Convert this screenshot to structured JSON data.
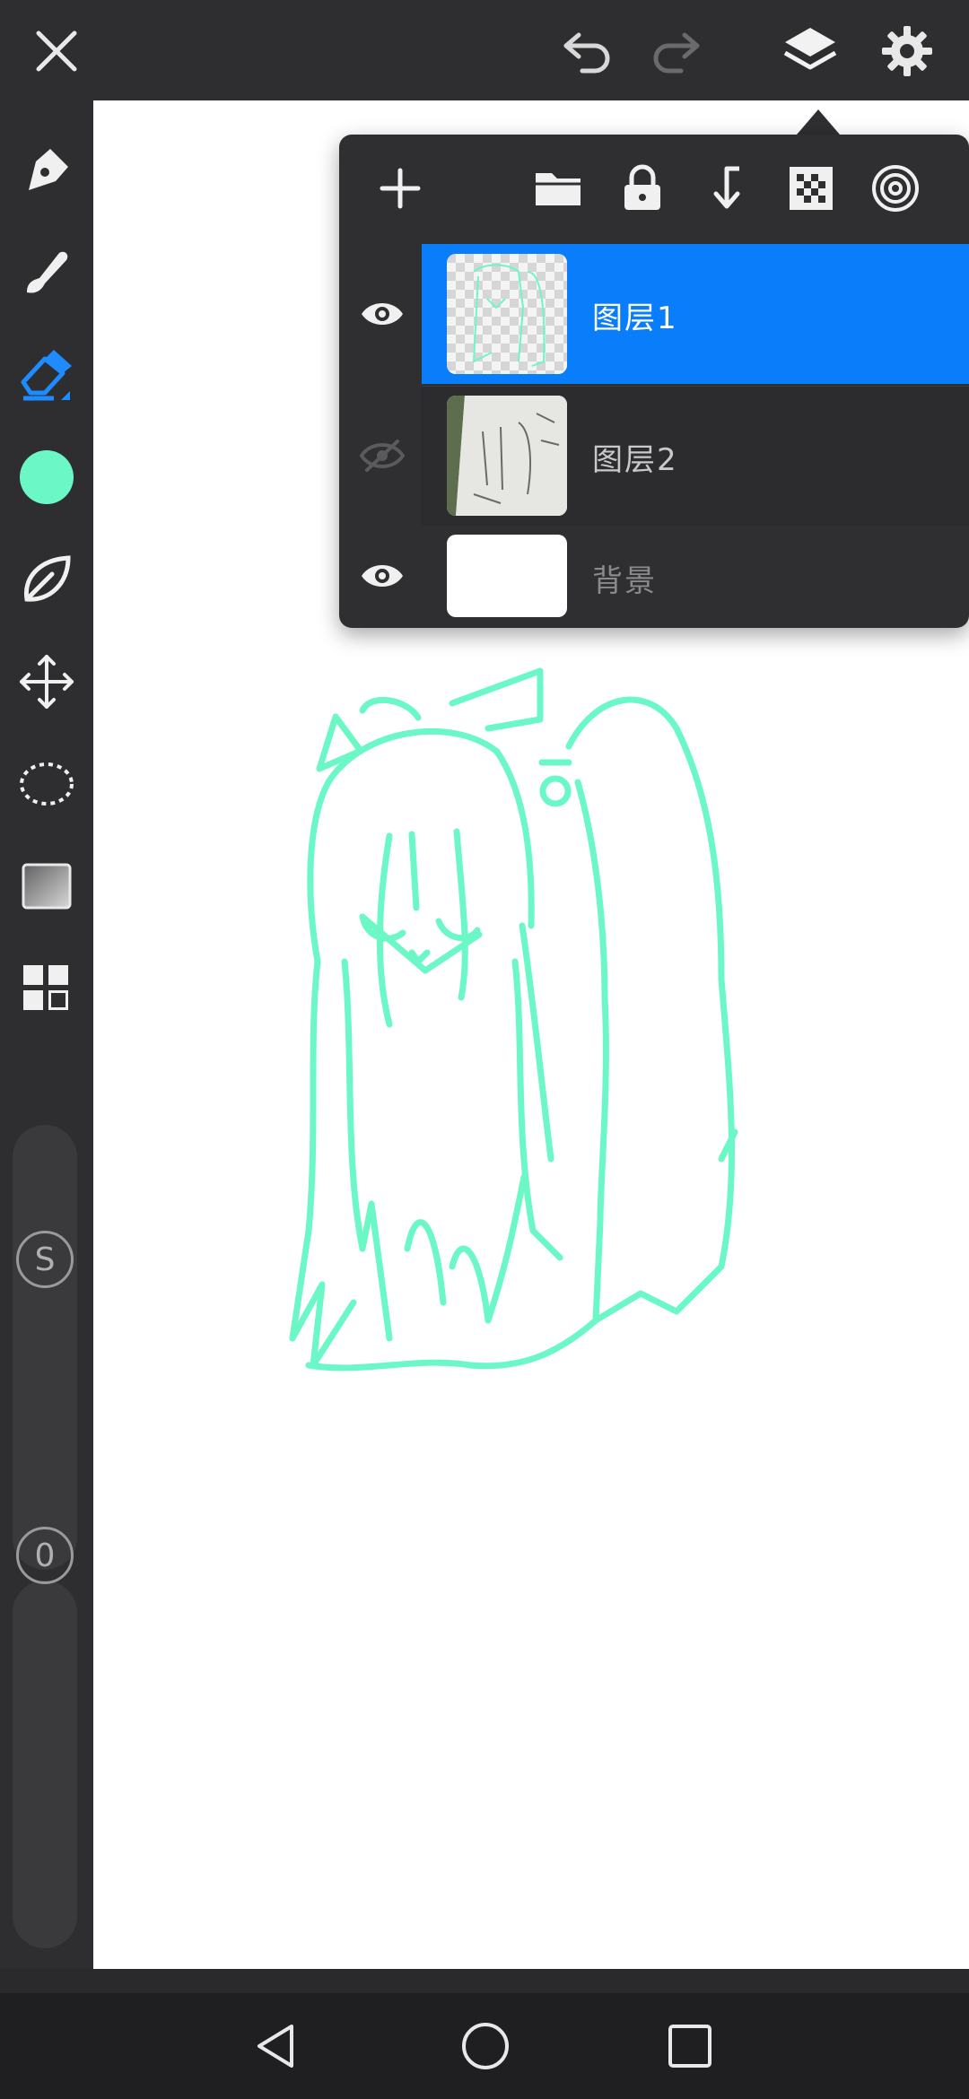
{
  "topbar": {
    "icons": [
      "close-icon",
      "undo-icon",
      "redo-icon",
      "layers-icon",
      "gear-icon"
    ]
  },
  "sidebar": {
    "tools": [
      "pen-icon",
      "brush-icon",
      "eraser-icon",
      "color-swatch",
      "leaf-icon",
      "move-icon",
      "lasso-icon",
      "gradient-icon",
      "grid-icon"
    ],
    "active_tool": "eraser-icon",
    "current_color": "#6cf7c7",
    "size_label": "S",
    "opacity_label": "0"
  },
  "layer_panel": {
    "toolbar_icons": [
      "plus-icon",
      "folder-icon",
      "lock-icon",
      "merge-down-icon",
      "checker-icon",
      "target-icon"
    ],
    "layers": [
      {
        "name": "图层1",
        "visible": true,
        "selected": true
      },
      {
        "name": "图层2",
        "visible": false,
        "selected": false
      },
      {
        "name": "背景",
        "visible": true,
        "selected": false
      }
    ]
  },
  "navbar": {
    "icons": [
      "back-icon",
      "home-icon",
      "recents-icon"
    ]
  },
  "colors": {
    "accent": "#0a7dfb",
    "stroke": "#6cf7c7",
    "panel": "#2f2f31"
  }
}
